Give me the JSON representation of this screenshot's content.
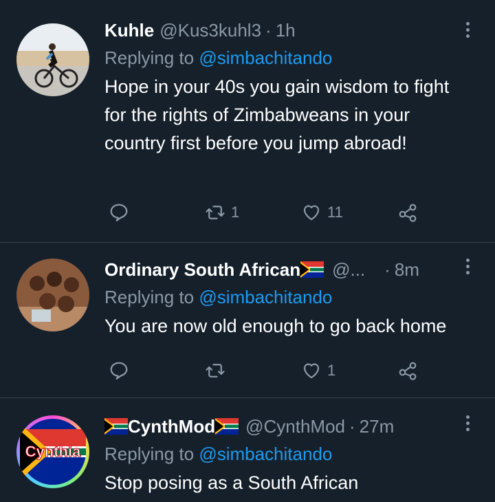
{
  "tweets": [
    {
      "name": "Kuhle",
      "handle": "@Kus3kuhl3",
      "sep": "·",
      "time": "1h",
      "reply_prefix": "Replying to",
      "reply_to": "@simbachitando",
      "text": "Hope in your 40s you gain wisdom to fight for the rights of Zimbabweans in your country first before you jump abroad!",
      "retweets": "1",
      "likes": "11"
    },
    {
      "name": "Ordinary South African",
      "handle": "@...",
      "sep": "·",
      "time": "8m",
      "reply_prefix": "Replying to",
      "reply_to": "@simbachitando",
      "text": "You are now old enough to go back home",
      "retweets": "",
      "likes": "1"
    },
    {
      "name": "CynthMod",
      "handle": "@CynthMod",
      "sep": "·",
      "time": "27m",
      "reply_prefix": "Replying to",
      "reply_to": "@simbachitando",
      "text": "Stop posing as a South African",
      "avatar_text": "Cynthia"
    }
  ],
  "colors": {
    "background": "#15202b",
    "muted": "#8b98a5",
    "link": "#1d9bf0",
    "divider": "#38444d"
  }
}
